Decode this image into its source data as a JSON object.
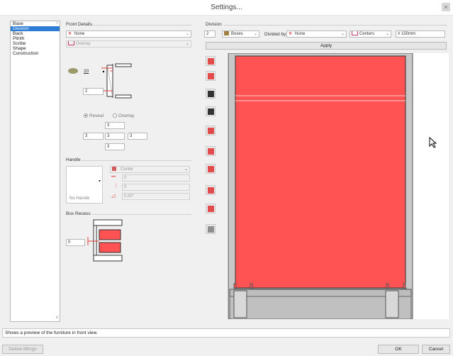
{
  "window": {
    "title": "Settings...",
    "close_label": "×"
  },
  "sidebar": {
    "items": [
      {
        "label": "Base"
      },
      {
        "label": "Division",
        "selected": true
      },
      {
        "label": "Back"
      },
      {
        "label": "Plinth"
      },
      {
        "label": "Scribe"
      },
      {
        "label": "Shape"
      },
      {
        "label": "Construction"
      }
    ]
  },
  "front_details": {
    "title": "Front Details",
    "front_type": "None",
    "front_style": "Overlay",
    "thickness": "20",
    "gap_value": "2",
    "radio_reveal": "Reveal",
    "radio_overlay": "Overlay",
    "reveal_top": "3",
    "reveal_left": "3",
    "reveal_center": "3",
    "reveal_right": "3",
    "reveal_bottom": "3"
  },
  "handle": {
    "title": "Handle",
    "preview_label": "No Handle",
    "position": "Center",
    "offset_h": "0",
    "offset_v": "0",
    "angle": "0.00°"
  },
  "box_recess": {
    "title": "Box Recess",
    "value": "0"
  },
  "division": {
    "title": "Division",
    "count": "2",
    "type": "Boxes",
    "divided_by_label": "Divided by",
    "divided_by": "None",
    "mode": "Centers",
    "size": "# 150mm",
    "apply_label": "Apply"
  },
  "status_text": "Shows a preview of the furniture in front view.",
  "footer": {
    "delete_label": "Delete fittings",
    "ok_label": "OK",
    "cancel_label": "Cancel"
  },
  "colors": {
    "accent": "#2d7cd6",
    "front_red": "#ff5252",
    "carcass_grey": "#c8c8c8"
  }
}
